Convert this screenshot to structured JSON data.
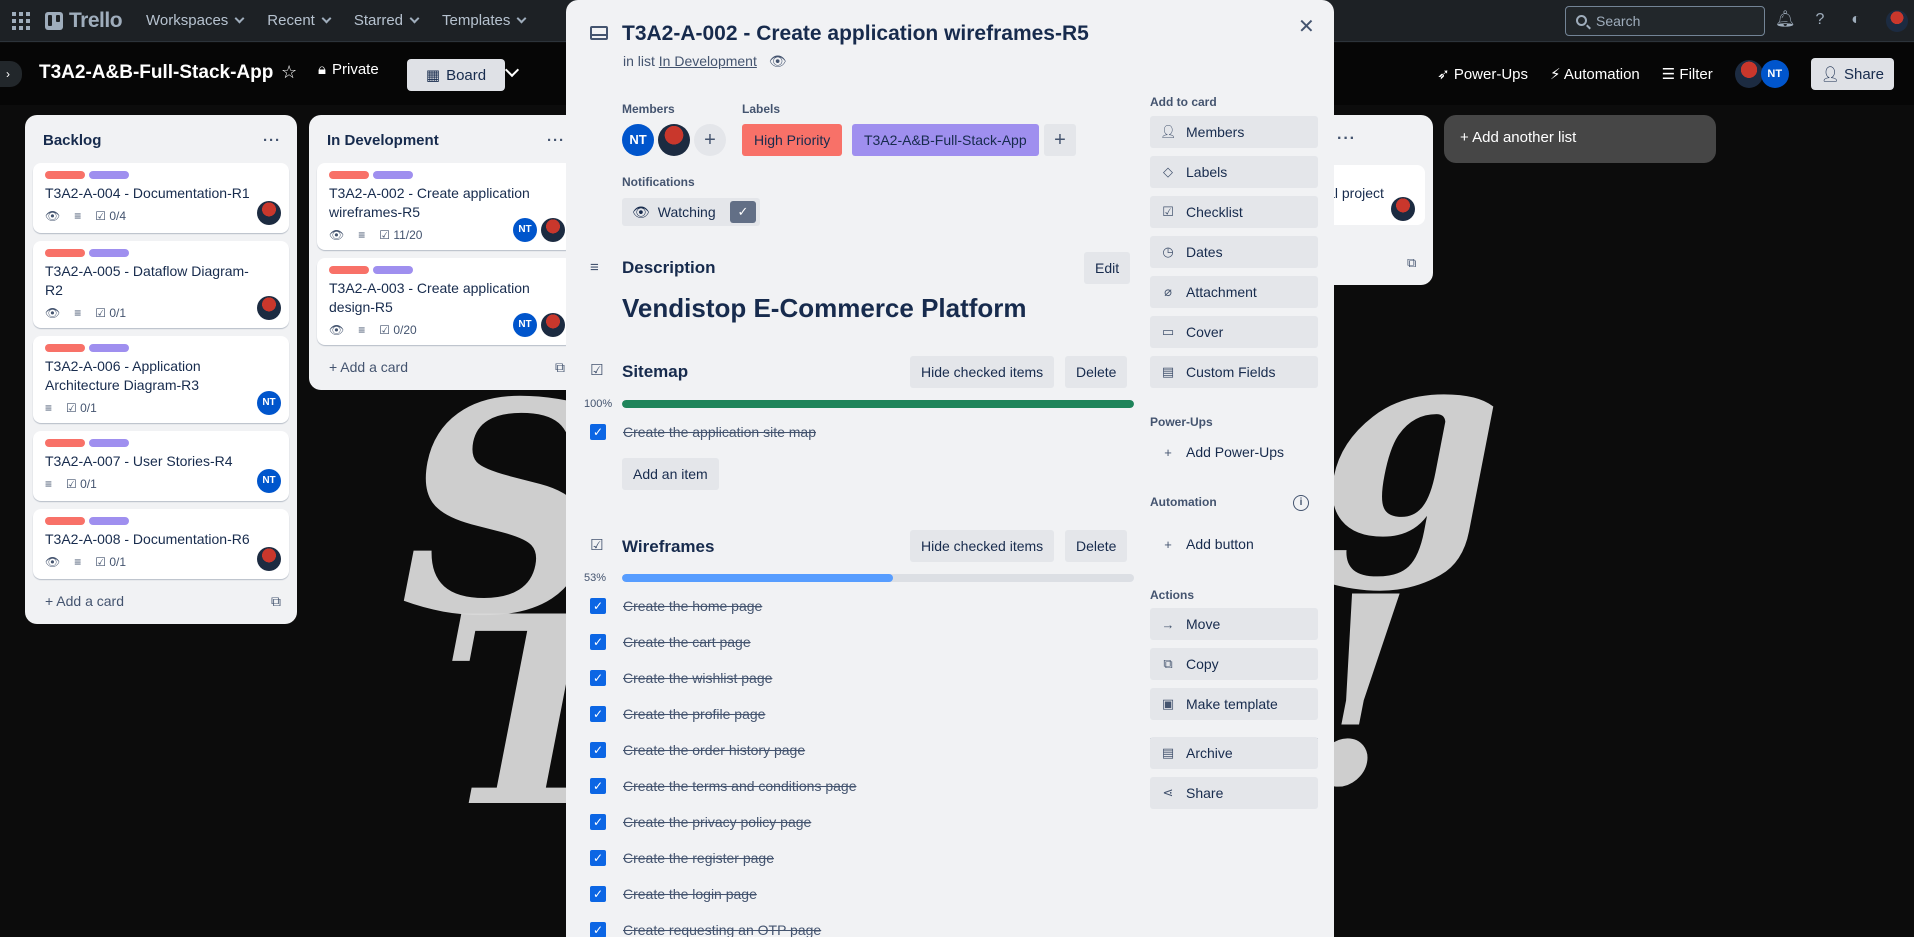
{
  "nav": {
    "brand": "Trello",
    "items": [
      "Workspaces",
      "Recent",
      "Starred",
      "Templates"
    ],
    "search_placeholder": "Search"
  },
  "board": {
    "title": "T3A2-A&B-Full-Stack-App",
    "visibility": "Private",
    "view": "Board",
    "actions": {
      "powerups": "Power-Ups",
      "automation": "Automation",
      "filter": "Filter",
      "share": "Share",
      "member_initials": "NT"
    },
    "add_list": "Add another list"
  },
  "lists": [
    {
      "title": "Backlog",
      "add_card": "Add a card",
      "cards": [
        {
          "title": "T3A2-A-004 - Documentation-R1",
          "checklist": "0/4",
          "avatar": "img"
        },
        {
          "title": "T3A2-A-005 - Dataflow Diagram-R2",
          "checklist": "0/1",
          "avatar": "img"
        },
        {
          "title": "T3A2-A-006 - Application Architecture Diagram-R3",
          "checklist": "0/1",
          "avatar": "NT"
        },
        {
          "title": "T3A2-A-007 - User Stories-R4",
          "checklist": "0/1",
          "avatar": "NT"
        },
        {
          "title": "T3A2-A-008 - Documentation-R6",
          "checklist": "0/1",
          "avatar": "img"
        }
      ]
    },
    {
      "title": "In Development",
      "add_card": "Add a card",
      "cards": [
        {
          "title": "T3A2-A-002 - Create application wireframes-R5",
          "checklist": "11/20",
          "avatar": "NT"
        },
        {
          "title": "T3A2-A-003 - Create application design-R5",
          "checklist": "0/20",
          "avatar": "NT"
        }
      ]
    }
  ],
  "partial_card_text": "ial project",
  "modal": {
    "title": "T3A2-A-002 - Create application wireframes-R5",
    "in_list_prefix": "in list",
    "in_list": "In Development",
    "members_label": "Members",
    "member_initials": "NT",
    "labels_label": "Labels",
    "labels": [
      {
        "text": "High Priority",
        "color": "#f87168"
      },
      {
        "text": "T3A2-A&B-Full-Stack-App",
        "color": "#9f8fef"
      }
    ],
    "notifications_label": "Notifications",
    "watching": "Watching",
    "description_label": "Description",
    "edit": "Edit",
    "description_text": "Vendistop E-Commerce Platform",
    "checklists": [
      {
        "title": "Sitemap",
        "hide": "Hide checked items",
        "delete": "Delete",
        "percent_label": "100%",
        "progress": 1.0,
        "bar_color": "#1f845a",
        "items": [
          "Create the application site map"
        ],
        "add_item": "Add an item"
      },
      {
        "title": "Wireframes",
        "hide": "Hide checked items",
        "delete": "Delete",
        "percent_label": "53%",
        "progress": 0.53,
        "bar_color": "#579dff",
        "items": [
          "Create the home page",
          "Create the cart page",
          "Create the wishlist page",
          "Create the profile page",
          "Create the order history page",
          "Create the terms and conditions page",
          "Create the privacy policy page",
          "Create the register page",
          "Create the login page",
          "Create requesting an OTP page"
        ]
      }
    ],
    "sidebar": {
      "add_to_card": "Add to card",
      "add_buttons": [
        "Members",
        "Labels",
        "Checklist",
        "Dates",
        "Attachment",
        "Cover",
        "Custom Fields"
      ],
      "powerups_label": "Power-Ups",
      "add_powerups": "Add Power-Ups",
      "automation_label": "Automation",
      "add_button": "Add button",
      "actions_label": "Actions",
      "actions": [
        "Move",
        "Copy",
        "Make template"
      ],
      "archive": "Archive",
      "share": "Share"
    }
  }
}
